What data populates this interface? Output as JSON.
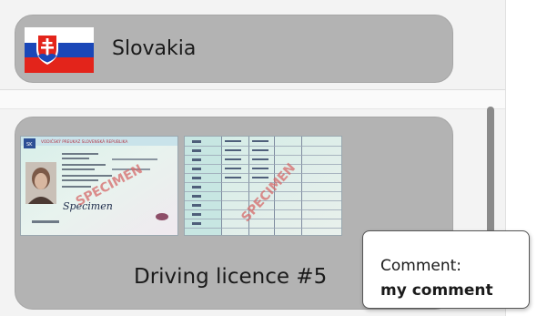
{
  "country": {
    "name": "Slovakia",
    "flag_icon": "slovakia-flag-icon",
    "flag_colors": {
      "white": "#ffffff",
      "blue": "#1a47b8",
      "red": "#e3241b"
    }
  },
  "document": {
    "title": "Driving licence #5",
    "front_image_icon": "license-front-image",
    "back_image_icon": "license-back-image",
    "front_card": {
      "header": "VODIČSKÝ PREUKAZ SLOVENSKÁ REPUBLIKA",
      "country_code": "SK",
      "signature": "Specimen",
      "watermark": "SPECIMEN"
    },
    "back_card": {
      "watermark": "SPECIMEN"
    }
  },
  "tooltip": {
    "heading": "Comment:",
    "value": "my comment"
  },
  "colors": {
    "card_background": "#b3b3b3",
    "panel_background": "#f3f3f3",
    "scrollbar_thumb": "#8a8a8a"
  }
}
